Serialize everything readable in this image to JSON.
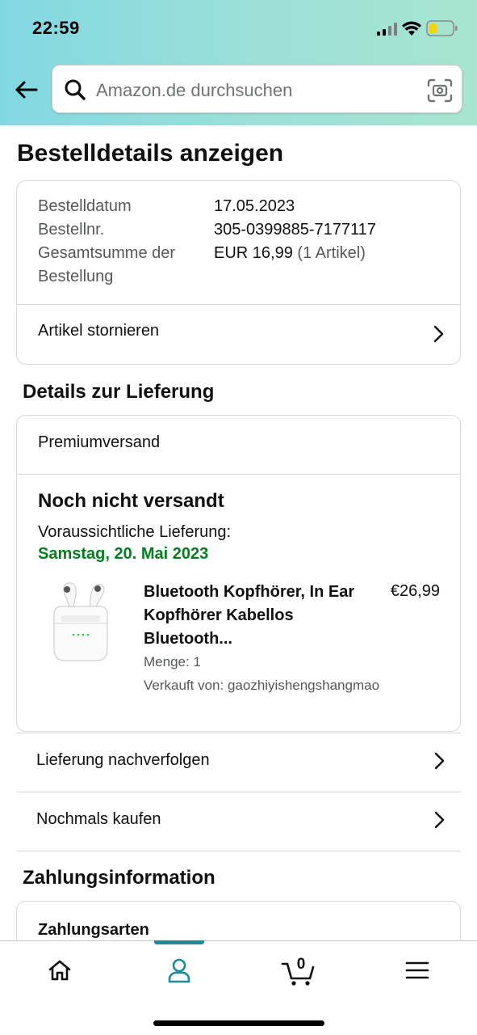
{
  "status_bar": {
    "time": "22:59"
  },
  "search": {
    "placeholder": "Amazon.de durchsuchen"
  },
  "page_title": "Bestelldetails anzeigen",
  "order_summary": {
    "date_label": "Bestelldatum",
    "date_value": "17.05.2023",
    "number_label": "Bestellnr.",
    "number_value": "305-0399885-7177117",
    "total_label_line1": "Gesamtsumme der",
    "total_label_line2": "Bestellung",
    "total_value": "EUR 16,99",
    "total_items": "(1 Artikel)",
    "cancel_label": "Artikel stornieren"
  },
  "delivery": {
    "heading": "Details zur Lieferung",
    "shipping_method": "Premiumversand",
    "status": "Noch nicht versandt",
    "eta_label": "Voraussichtliche Lieferung:",
    "eta_date": "Samstag, 20. Mai 2023",
    "product": {
      "title": "Bluetooth Kopfhörer, In Ear Kopfhörer Kabellos Bluetooth...",
      "price": "€26,99",
      "quantity": "Menge: 1",
      "seller": "Verkauft von: gaozhiyishengshangmao"
    }
  },
  "actions": {
    "track": "Lieferung nachverfolgen",
    "buy_again": "Nochmals kaufen"
  },
  "payment": {
    "heading": "Zahlungsinformation",
    "methods_title": "Zahlungsarten"
  },
  "bottom_nav": {
    "cart_count": "0",
    "active_tab": "account",
    "accent_color": "#1c8a97"
  },
  "colors": {
    "eta_green": "#067d1f",
    "header_gradient_start": "#82d8e2",
    "header_gradient_end": "#a7e5cf"
  }
}
